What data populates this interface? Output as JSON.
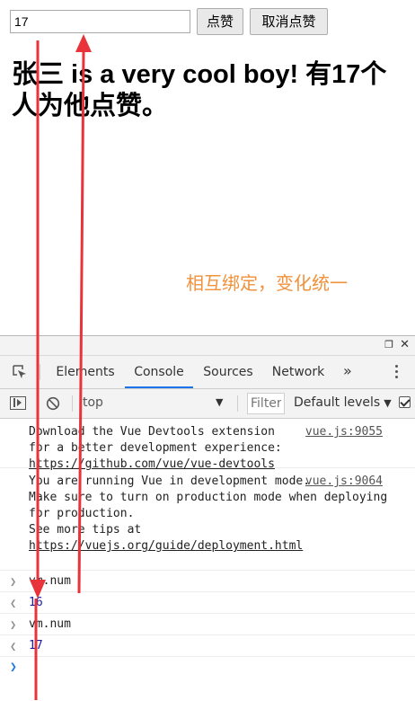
{
  "app": {
    "num_value": "17",
    "like_button": "点赞",
    "unlike_button": "取消点赞",
    "headline": "张三 is a very cool boy! 有17个人为他点赞。",
    "annotation": "相互绑定，变化统一"
  },
  "devtools": {
    "tabs": [
      "Elements",
      "Console",
      "Sources",
      "Network"
    ],
    "more_tabs": "»",
    "context": "top",
    "filter_placeholder": "Filter",
    "levels": "Default levels",
    "group_similar_checked": true,
    "messages": [
      {
        "text": "Download the Vue Devtools extension for a better development experience:",
        "link": "https://github.com/vue/vue-devtools",
        "source": "vue.js:9055"
      },
      {
        "text": "You are running Vue in development mode.\nMake sure to turn on production mode when deploying for production.\nSee more tips at ",
        "link": "https://vuejs.org/guide/deployment.html",
        "source": "vue.js:9064"
      }
    ],
    "history": [
      {
        "input": "vm.num",
        "output": "16"
      },
      {
        "input": "vm.num",
        "output": "17"
      }
    ]
  },
  "icons": {
    "undock": "undock-icon",
    "close": "close-icon",
    "inspect": "inspect-element-icon",
    "sidebar": "console-sidebar-icon",
    "clear": "clear-console-icon",
    "prompt": "chevron-right-icon",
    "result": "chevron-left-icon"
  },
  "colors": {
    "annotation": "#f0913c",
    "arrow": "#e8333a",
    "active_tab": "#1a73e8",
    "result_value": "#1a1aa6"
  }
}
